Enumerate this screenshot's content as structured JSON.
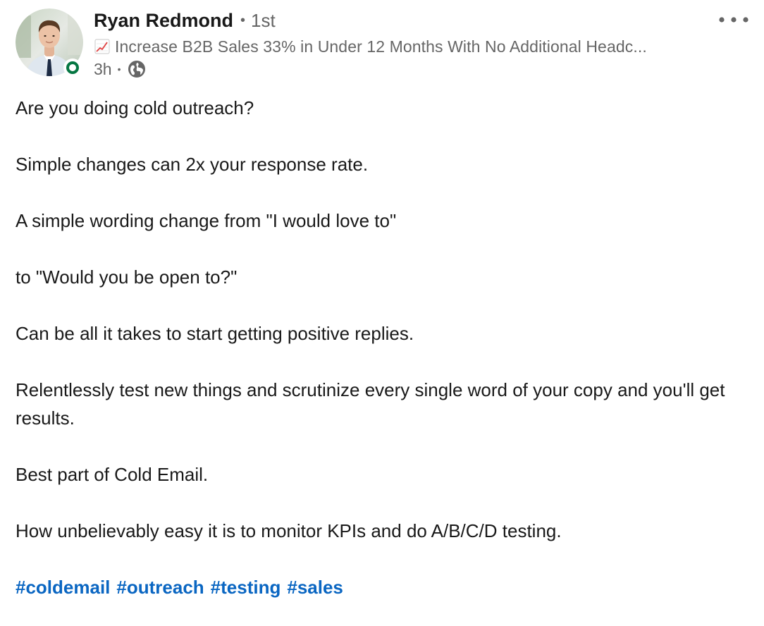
{
  "author": {
    "name": "Ryan Redmond",
    "separator": "•",
    "connection_degree": "1st",
    "headline": "Increase B2B Sales 33% in Under 12 Months With No Additional Headc...",
    "headline_icon": "chart-increasing-emoji",
    "time_ago": "3h",
    "meta_separator": "•",
    "visibility_icon": "globe-icon",
    "online_status_color": "#057642"
  },
  "menu": {
    "more_icon": "ellipsis-icon"
  },
  "post": {
    "paragraphs": [
      "Are you doing cold outreach?",
      "Simple changes can 2x your response rate.",
      "A simple wording change from \"I would love to\"",
      "to \"Would you be open to?\"",
      "Can be all it takes to start getting positive replies.",
      "Relentlessly test new things and scrutinize every single word of your copy and you'll get results.",
      "Best part of Cold Email.",
      "How unbelievably easy it is to monitor KPIs and do A/B/C/D testing."
    ],
    "hashtags": [
      "#coldemail",
      "#outreach",
      "#testing",
      "#sales"
    ]
  },
  "colors": {
    "text": "#191919",
    "secondary_text": "#666666",
    "hashtag": "#0a66c2"
  }
}
